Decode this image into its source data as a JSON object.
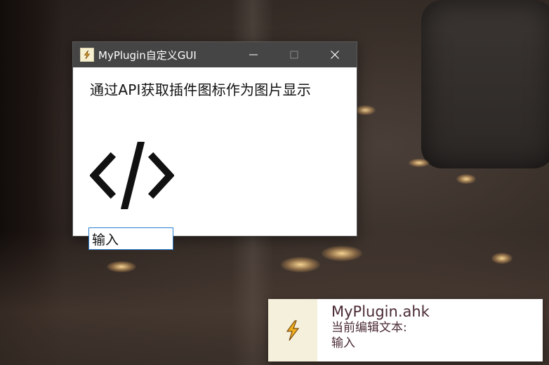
{
  "window": {
    "title": "MyPlugin自定义GUI",
    "controls": [
      "minimize-icon",
      "maximize-icon",
      "close-icon"
    ],
    "caption": "通过API获取插件图标作为图片显示",
    "image_icon": "code-brackets-icon",
    "input_value": "输入",
    "titlebar_color": "#454545",
    "input_border_color": "#2a7fcf"
  },
  "toast": {
    "icon": "lightning-bolt-icon",
    "title": "MyPlugin.ahk",
    "label": "当前编辑文本:",
    "value": "输入",
    "text_color": "#4a2a35"
  }
}
